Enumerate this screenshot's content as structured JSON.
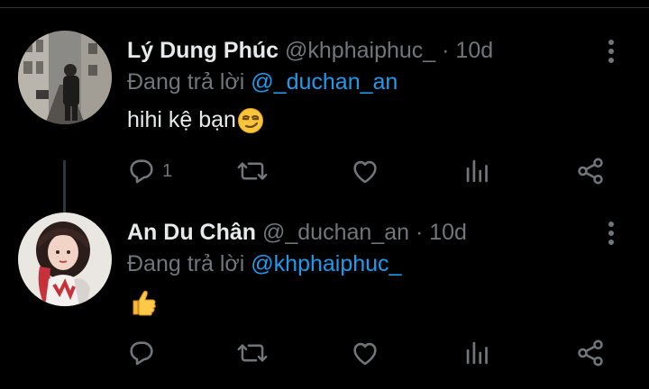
{
  "tweets": [
    {
      "name": "Lý Dung Phúc",
      "handle": "@khphaiphuc_",
      "separator": "·",
      "time": "10d",
      "reply_prefix": "Đang trả lời",
      "reply_to": "@_duchan_an",
      "text": "hihi kệ bạn",
      "emoji": "smirking-face",
      "reply_count": "1",
      "icons": [
        "reply-icon",
        "retweet-icon",
        "like-icon",
        "analytics-icon",
        "share-icon",
        "more-icon"
      ]
    },
    {
      "name": "An Du Chân",
      "handle": "@_duchan_an",
      "separator": "·",
      "time": "10d",
      "reply_prefix": "Đang trả lời",
      "reply_to": "@khphaiphuc_",
      "text": "",
      "emoji": "thumbs-up",
      "reply_count": "",
      "icons": [
        "reply-icon",
        "retweet-icon",
        "like-icon",
        "analytics-icon",
        "share-icon",
        "more-icon"
      ]
    }
  ],
  "colors": {
    "background": "#000000",
    "primary_text": "#e7e9ea",
    "secondary_text": "#71767b",
    "mention": "#1d9bf0",
    "thread_line": "#333639"
  }
}
